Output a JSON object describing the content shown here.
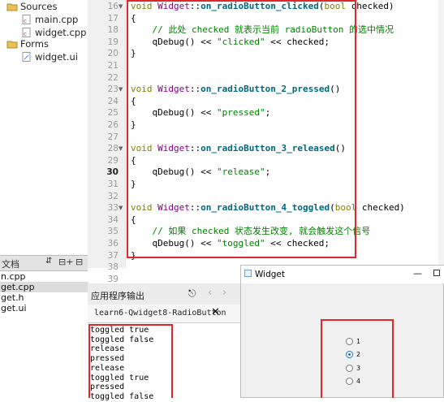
{
  "tree": {
    "items": [
      {
        "label": "Sources",
        "icon": "folder-sources-icon"
      },
      {
        "label": "main.cpp",
        "icon": "cpp-file-icon"
      },
      {
        "label": "widget.cpp",
        "icon": "cpp-file-icon"
      },
      {
        "label": "Forms",
        "icon": "folder-forms-icon"
      },
      {
        "label": "widget.ui",
        "icon": "ui-file-icon"
      }
    ]
  },
  "open_docs": {
    "header": "文档",
    "items": [
      "n.cpp",
      "get.cpp",
      "get.h",
      "get.ui"
    ]
  },
  "editor": {
    "lines": [
      {
        "n": "16",
        "segs": [
          [
            "kw",
            "void "
          ],
          [
            "ty",
            "Widget"
          ],
          [
            "",
            "::"
          ],
          [
            "fn",
            "on_radioButton_clicked"
          ],
          [
            "",
            "("
          ],
          [
            "kw",
            "bool "
          ],
          [
            "",
            "checked)"
          ]
        ]
      },
      {
        "n": "17",
        "segs": [
          [
            "",
            "{"
          ]
        ]
      },
      {
        "n": "18",
        "segs": [
          [
            "cm",
            "    // 此处 checked 就表示当前 radioButton 的选中情况"
          ]
        ]
      },
      {
        "n": "19",
        "segs": [
          [
            "",
            "    qDebug() << "
          ],
          [
            "str",
            "\"clicked\""
          ],
          [
            "",
            " << checked;"
          ]
        ]
      },
      {
        "n": "20",
        "segs": [
          [
            "",
            "}"
          ]
        ]
      },
      {
        "n": "21",
        "segs": []
      },
      {
        "n": "22",
        "segs": []
      },
      {
        "n": "23",
        "segs": [
          [
            "kw",
            "void "
          ],
          [
            "ty",
            "Widget"
          ],
          [
            "",
            "::"
          ],
          [
            "fn",
            "on_radioButton_2_pressed"
          ],
          [
            "",
            "()"
          ]
        ]
      },
      {
        "n": "24",
        "segs": [
          [
            "",
            "{"
          ]
        ]
      },
      {
        "n": "25",
        "segs": [
          [
            "",
            "    qDebug() << "
          ],
          [
            "str",
            "\"pressed\""
          ],
          [
            "",
            ";"
          ]
        ]
      },
      {
        "n": "26",
        "segs": [
          [
            "",
            "}"
          ]
        ]
      },
      {
        "n": "27",
        "segs": []
      },
      {
        "n": "28",
        "segs": [
          [
            "kw",
            "void "
          ],
          [
            "ty",
            "Widget"
          ],
          [
            "",
            "::"
          ],
          [
            "fn",
            "on_radioButton_3_released"
          ],
          [
            "",
            "()"
          ]
        ]
      },
      {
        "n": "29",
        "segs": [
          [
            "",
            "{"
          ]
        ]
      },
      {
        "n": "30",
        "segs": [
          [
            "",
            "    qDebug() << "
          ],
          [
            "str",
            "\"release\""
          ],
          [
            "",
            ";"
          ]
        ]
      },
      {
        "n": "31",
        "segs": [
          [
            "",
            "}"
          ]
        ]
      },
      {
        "n": "32",
        "segs": []
      },
      {
        "n": "33",
        "segs": [
          [
            "kw",
            "void "
          ],
          [
            "ty",
            "Widget"
          ],
          [
            "",
            "::"
          ],
          [
            "fn",
            "on_radioButton_4_toggled"
          ],
          [
            "",
            "("
          ],
          [
            "kw",
            "bool "
          ],
          [
            "",
            "checked)"
          ]
        ]
      },
      {
        "n": "34",
        "segs": [
          [
            "",
            "{"
          ]
        ]
      },
      {
        "n": "35",
        "segs": [
          [
            "cm",
            "    // 如果 checked 状态发生改变, 就会触发这个信号"
          ]
        ]
      },
      {
        "n": "36",
        "segs": [
          [
            "",
            "    qDebug() << "
          ],
          [
            "str",
            "\"toggled\""
          ],
          [
            "",
            " << checked;"
          ]
        ]
      },
      {
        "n": "37",
        "segs": [
          [
            "",
            "}"
          ]
        ]
      },
      {
        "n": "38",
        "segs": []
      },
      {
        "n": "39",
        "segs": []
      }
    ],
    "current_line": "30"
  },
  "output": {
    "title": "应用程序输出",
    "tab_label": "learn6-Qwidget8-RadioButton",
    "lines": [
      "toggled true",
      "toggled false",
      "release",
      "pressed",
      "release",
      "toggled true",
      "pressed",
      "toggled false"
    ]
  },
  "widget_window": {
    "title": "Widget",
    "radios": [
      {
        "label": "1",
        "checked": false
      },
      {
        "label": "2",
        "checked": true
      },
      {
        "label": "3",
        "checked": false
      },
      {
        "label": "4",
        "checked": false
      }
    ]
  },
  "colors": {
    "highlight_border": "#e2262c",
    "radio_accent": "#1f6fd4"
  }
}
